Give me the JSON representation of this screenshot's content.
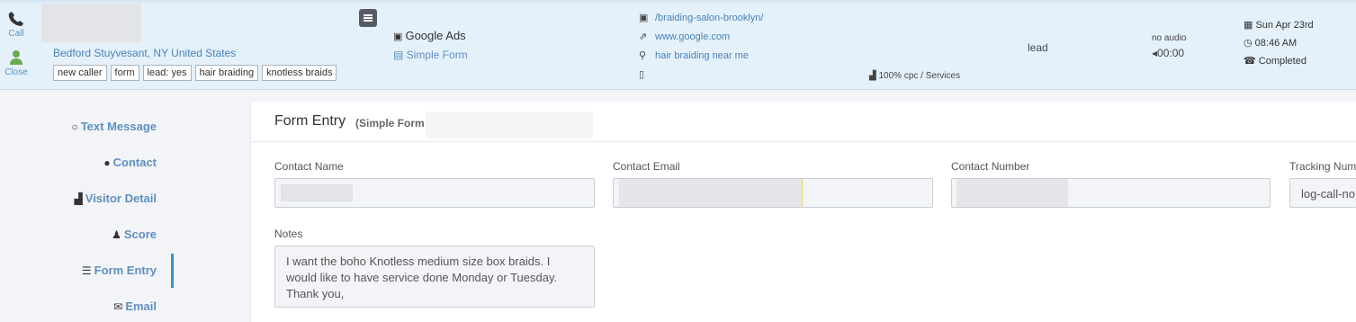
{
  "call": {
    "actions": [
      {
        "label": "Call",
        "icon": "phone-icon"
      },
      {
        "label": "Close",
        "icon": "user-icon"
      }
    ],
    "location": "Bedford Stuyvesant, NY United States",
    "tags": [
      "new caller",
      "form",
      "lead: yes",
      "hair braiding",
      "knotless braids"
    ],
    "source": "Google Ads",
    "form_type": "Simple Form",
    "landing_page": "/braiding-salon-brooklyn/",
    "referrer": "www.google.com",
    "keyword": "hair braiding near me",
    "campaign": "100% cpc / Services",
    "status": "lead",
    "audio_label": "no audio",
    "audio_time": "00:00",
    "date": "Sun Apr 23rd",
    "time": "08:46 AM",
    "call_status": "Completed"
  },
  "nav": {
    "items": [
      {
        "label": "Text Message",
        "icon": "speech-bubble-icon",
        "glyph": "💬"
      },
      {
        "label": "Contact",
        "icon": "user-icon",
        "glyph": "👤"
      },
      {
        "label": "Visitor Detail",
        "icon": "bar-chart-icon",
        "glyph": "📊"
      },
      {
        "label": "Score",
        "icon": "person-tie-icon",
        "glyph": "♟"
      },
      {
        "label": "Form Entry",
        "icon": "list-icon",
        "glyph": "☰"
      },
      {
        "label": "Email",
        "icon": "envelope-icon",
        "glyph": "✉"
      }
    ],
    "active": "Form Entry"
  },
  "form_entry": {
    "title": "Form Entry",
    "subtitle": "(Simple Form",
    "fields": [
      {
        "label": "Contact Name",
        "value": ""
      },
      {
        "label": "Contact Email",
        "value": ""
      },
      {
        "label": "Contact Number",
        "value": ""
      },
      {
        "label": "Tracking Num",
        "value": "log-call-no"
      }
    ],
    "notes_label": "Notes",
    "notes": "I want the boho Knotless medium size box braids. I would like to have service done Monday or Tuesday. Thank you,"
  }
}
